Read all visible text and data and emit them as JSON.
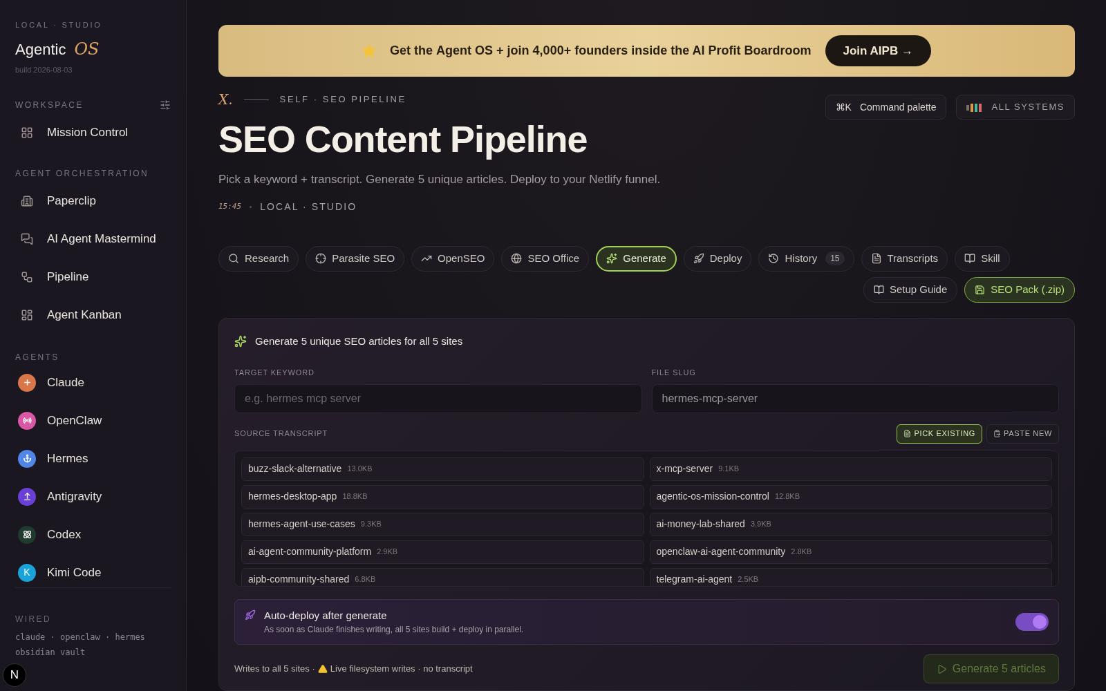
{
  "sidebar": {
    "eyebrow": "LOCAL · STUDIO",
    "brand": "Agentic",
    "brand_accent": "OS",
    "build": "build 2026-08-03",
    "sections": [
      {
        "title": "WORKSPACE",
        "has_settings": true,
        "items": [
          {
            "label": "Mission Control"
          }
        ]
      },
      {
        "title": "AGENT ORCHESTRATION",
        "has_settings": false,
        "items": [
          {
            "label": "Paperclip"
          },
          {
            "label": "AI Agent Mastermind"
          },
          {
            "label": "Pipeline"
          },
          {
            "label": "Agent Kanban"
          }
        ]
      }
    ],
    "agents_title": "AGENTS",
    "agents": [
      {
        "label": "Claude",
        "color": "#d9774a"
      },
      {
        "label": "OpenClaw",
        "color": "#d957a5"
      },
      {
        "label": "Hermes",
        "color": "#4f86e8"
      },
      {
        "label": "Antigravity",
        "color": "#6a3fd6"
      },
      {
        "label": "Codex",
        "color": "#1f3a2e"
      },
      {
        "label": "Kimi Code",
        "color": "#1aa3d9",
        "initial": "K"
      }
    ],
    "wired_title": "WIRED",
    "wired_lines": [
      "claude · openclaw · hermes",
      "obsidian vault"
    ],
    "dev_badge": "N"
  },
  "banner": {
    "text": "Get the **Agent OS** + join **4,000+ founders** inside the AI Profit Boardroom",
    "button": "Join AIPB →"
  },
  "header": {
    "logo": "X.",
    "eyebrow": "SELF · SEO PIPELINE",
    "title": "SEO Content Pipeline",
    "subtitle": "Pick a keyword + transcript. Generate 5 unique articles. Deploy to your Netlify funnel.",
    "time": "15:45",
    "location": "LOCAL · STUDIO",
    "shortcut": "⌘K",
    "command": "Command palette",
    "systems": "ALL SYSTEMS"
  },
  "tabs": [
    {
      "label": "Research",
      "selected": false
    },
    {
      "label": "Parasite SEO",
      "selected": false
    },
    {
      "label": "OpenSEO",
      "selected": false
    },
    {
      "label": "SEO Office",
      "selected": false
    },
    {
      "label": "Generate",
      "selected": true
    },
    {
      "label": "Deploy",
      "selected": false
    },
    {
      "label": "History",
      "selected": false,
      "count": "15"
    },
    {
      "label": "Transcripts",
      "selected": false
    },
    {
      "label": "Skill",
      "selected": false
    }
  ],
  "actions": [
    {
      "label": "Setup Guide",
      "kind": "plain"
    },
    {
      "label": "SEO Pack (.zip)",
      "kind": "accent"
    }
  ],
  "card": {
    "title": "Generate 5 unique SEO articles for all 5 sites",
    "keyword": {
      "label": "TARGET KEYWORD",
      "placeholder": "e.g. hermes mcp server"
    },
    "slug": {
      "label": "FILE SLUG",
      "value": "hermes-mcp-server"
    },
    "transcript_label": "SOURCE TRANSCRIPT",
    "modes": [
      {
        "label": "PICK EXISTING",
        "selected": true
      },
      {
        "label": "PASTE NEW",
        "selected": false
      }
    ],
    "transcripts": [
      {
        "name": "buzz-slack-alternative",
        "size": "13.0KB"
      },
      {
        "name": "x-mcp-server",
        "size": "9.1KB"
      },
      {
        "name": "hermes-desktop-app",
        "size": "18.8KB"
      },
      {
        "name": "agentic-os-mission-control",
        "size": "12.8KB"
      },
      {
        "name": "hermes-agent-use-cases",
        "size": "9.3KB"
      },
      {
        "name": "ai-money-lab-shared",
        "size": "3.9KB"
      },
      {
        "name": "ai-agent-community-platform",
        "size": "2.9KB"
      },
      {
        "name": "openclaw-ai-agent-community",
        "size": "2.8KB"
      },
      {
        "name": "aipb-community-shared",
        "size": "6.8KB"
      },
      {
        "name": "telegram-ai-agent",
        "size": "2.5KB"
      }
    ],
    "auto_deploy": {
      "title": "Auto-deploy after generate",
      "description": "As soon as Claude finishes writing, all 5 sites build + deploy in parallel.",
      "on": true
    },
    "footer_left": "Writes to all 5 sites ·",
    "footer_warning": "Live filesystem writes · no transcript",
    "generate": {
      "label": "Generate 5 articles",
      "disabled": true
    }
  }
}
